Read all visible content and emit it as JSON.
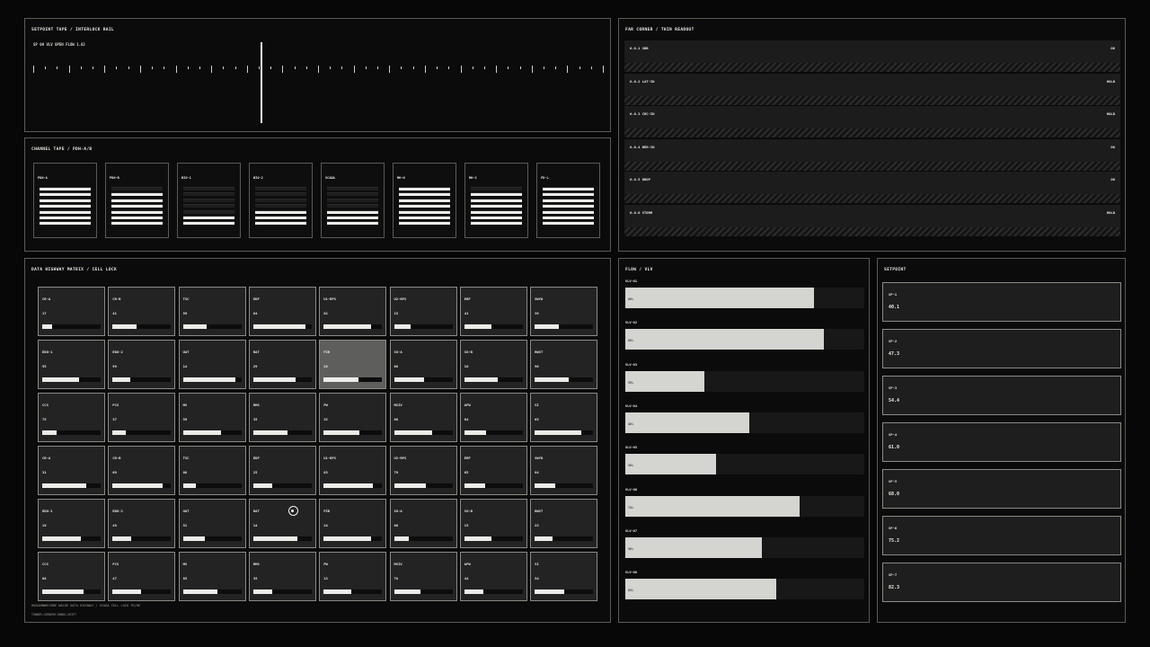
{
  "tape": {
    "title": "SETPOINT TAPE / INTERLOCK RAIL",
    "readout": "SP 09 VLV OPEN FLOW 1.82"
  },
  "channel": {
    "title": "CHANNEL TAPE / PDH-A/B",
    "items": [
      {
        "label": "PDH-A",
        "on": 7
      },
      {
        "label": "PDH-B",
        "on": 6
      },
      {
        "label": "BIO-1",
        "on": 2
      },
      {
        "label": "BIO-2",
        "on": 3
      },
      {
        "label": "SCADA",
        "on": 3
      },
      {
        "label": "MH-N",
        "on": 7
      },
      {
        "label": "MH-S",
        "on": 6
      },
      {
        "label": "FD-L",
        "on": 7
      }
    ]
  },
  "far": {
    "title": "FAR CORNER / THIN READOUT",
    "rows": [
      {
        "name": "0.0.1 SBB",
        "status": "OK"
      },
      {
        "name": "0.0.2 LAT-IN",
        "status": "HOLD"
      },
      {
        "name": "0.0.3 CRC-IN",
        "status": "HOLD"
      },
      {
        "name": "0.0.4 BER-IN",
        "status": "OK"
      },
      {
        "name": "0.0.5 DROP",
        "status": "OK"
      },
      {
        "name": "0.0.6 STORM",
        "status": "HOLD"
      }
    ]
  },
  "matrix": {
    "title": "DATA HIGHWAY MATRIX / CELL LOCK",
    "footer1": "HUDOOMWRECMDE  WACUE  DATA HIGHWAY / SCADA CELL LOCK  TR/HE",
    "footer2": "TUNNER-CORNERR-ORNOG-SHIFT",
    "cells": [
      {
        "name": "CR-A",
        "value": "17",
        "level": 0.17
      },
      {
        "name": "CR-B",
        "value": "41",
        "level": 0.41
      },
      {
        "name": "TSC",
        "value": "59",
        "level": 0.4
      },
      {
        "name": "EDF",
        "value": "84",
        "level": 0.89
      },
      {
        "name": "U1-RPS",
        "value": "82",
        "level": 0.82
      },
      {
        "name": "U2-RPS",
        "value": "23",
        "level": 0.28
      },
      {
        "name": "ERF",
        "value": "41",
        "level": 0.46
      },
      {
        "name": "SWYD",
        "value": "39",
        "level": 0.41
      },
      {
        "name": "EDG-1",
        "value": "95",
        "level": 0.63
      },
      {
        "name": "EDG-2",
        "value": "99",
        "level": 0.31
      },
      {
        "name": "UAT",
        "value": "14",
        "level": 0.9
      },
      {
        "name": "RAT",
        "value": "29",
        "level": 0.72
      },
      {
        "name": "PZR",
        "value": "20",
        "level": 0.59
      },
      {
        "name": "SG-A",
        "value": "68",
        "level": 0.52
      },
      {
        "name": "SG-B",
        "value": "16",
        "level": 0.58
      },
      {
        "name": "RWST",
        "value": "96",
        "level": 0.58
      },
      {
        "name": "CCS",
        "value": "75",
        "level": 0.24
      },
      {
        "name": "PCS",
        "value": "37",
        "level": 0.22
      },
      {
        "name": "MS",
        "value": "59",
        "level": 0.65
      },
      {
        "name": "RMS",
        "value": "35",
        "level": 0.59
      },
      {
        "name": "FW",
        "value": "32",
        "level": 0.62
      },
      {
        "name": "MSIV",
        "value": "86",
        "level": 0.66
      },
      {
        "name": "AFW",
        "value": "84",
        "level": 0.38
      },
      {
        "name": "SI",
        "value": "63",
        "level": 0.8
      },
      {
        "name": "CR-A",
        "value": "31",
        "level": 0.76
      },
      {
        "name": "CR-B",
        "value": "69",
        "level": 0.85
      },
      {
        "name": "TSC",
        "value": "08",
        "level": 0.22
      },
      {
        "name": "EDF",
        "value": "25",
        "level": 0.33
      },
      {
        "name": "U1-RPS",
        "value": "83",
        "level": 0.84
      },
      {
        "name": "U2-RPS",
        "value": "79",
        "level": 0.54
      },
      {
        "name": "ERF",
        "value": "65",
        "level": 0.35
      },
      {
        "name": "SWYD",
        "value": "84",
        "level": 0.36
      },
      {
        "name": "EDG-1",
        "value": "19",
        "level": 0.66
      },
      {
        "name": "EDG-2",
        "value": "49",
        "level": 0.32
      },
      {
        "name": "UAT",
        "value": "51",
        "level": 0.38
      },
      {
        "name": "RAT",
        "value": "14",
        "level": 0.76
      },
      {
        "name": "PZR",
        "value": "24",
        "level": 0.82
      },
      {
        "name": "SG-A",
        "value": "06",
        "level": 0.25
      },
      {
        "name": "SG-B",
        "value": "15",
        "level": 0.47
      },
      {
        "name": "RWST",
        "value": "23",
        "level": 0.3
      },
      {
        "name": "CCS",
        "value": "88",
        "level": 0.7
      },
      {
        "name": "PCS",
        "value": "47",
        "level": 0.49
      },
      {
        "name": "MS",
        "value": "85",
        "level": 0.59
      },
      {
        "name": "RMS",
        "value": "35",
        "level": 0.32
      },
      {
        "name": "FW",
        "value": "13",
        "level": 0.48
      },
      {
        "name": "MSIV",
        "value": "78",
        "level": 0.45
      },
      {
        "name": "AFW",
        "value": "44",
        "level": 0.33
      },
      {
        "name": "SI",
        "value": "54",
        "level": 0.5
      }
    ]
  },
  "flow": {
    "title": "FLOW / VLV",
    "items": [
      {
        "name": "VLV-01",
        "pct": "80%",
        "level": 0.79
      },
      {
        "name": "VLV-02",
        "pct": "88%",
        "level": 0.83
      },
      {
        "name": "VLV-03",
        "pct": "39%",
        "level": 0.33
      },
      {
        "name": "VLV-04",
        "pct": "48%",
        "level": 0.52
      },
      {
        "name": "VLV-05",
        "pct": "38%",
        "level": 0.38
      },
      {
        "name": "VLV-06",
        "pct": "74%",
        "level": 0.73
      },
      {
        "name": "VLV-07",
        "pct": "58%",
        "level": 0.57
      },
      {
        "name": "VLV-08",
        "pct": "63%",
        "level": 0.63
      }
    ]
  },
  "setpoint": {
    "title": "SETPOINT",
    "items": [
      {
        "name": "SP-1",
        "value": "40.1"
      },
      {
        "name": "SP-2",
        "value": "47.3"
      },
      {
        "name": "SP-3",
        "value": "54.4"
      },
      {
        "name": "SP-4",
        "value": "61.0"
      },
      {
        "name": "SP-5",
        "value": "68.0"
      },
      {
        "name": "SP-6",
        "value": "75.2"
      },
      {
        "name": "SP-7",
        "value": "82.3"
      }
    ]
  }
}
